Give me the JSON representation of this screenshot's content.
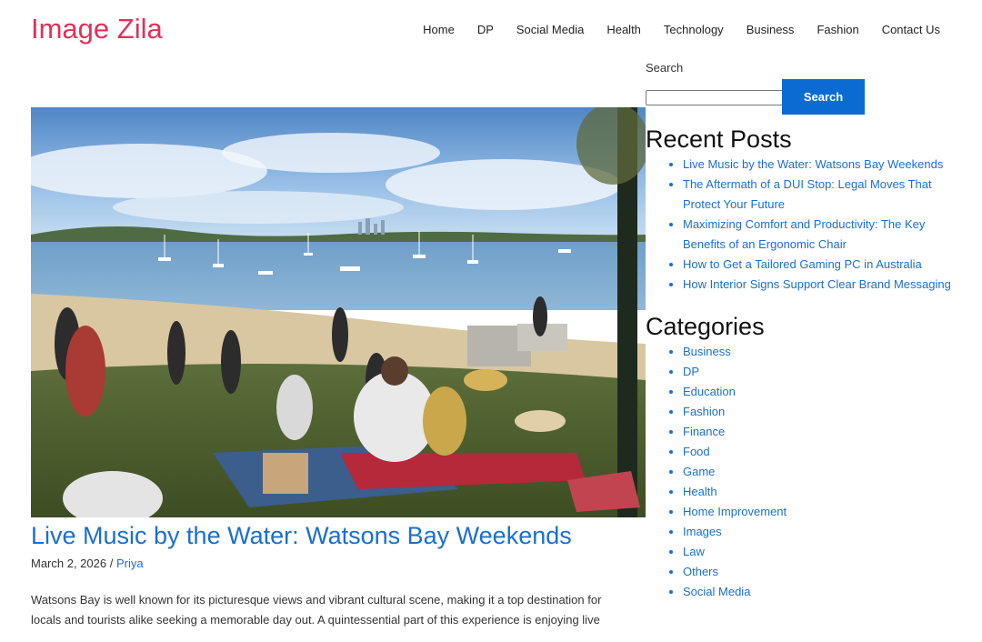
{
  "site": {
    "title": "Image Zila"
  },
  "nav": {
    "items": [
      {
        "label": "Home"
      },
      {
        "label": "DP"
      },
      {
        "label": "Social Media"
      },
      {
        "label": "Health"
      },
      {
        "label": "Technology"
      },
      {
        "label": "Business"
      },
      {
        "label": "Fashion"
      },
      {
        "label": "Contact Us"
      }
    ]
  },
  "post": {
    "title": "Live Music by the Water: Watsons Bay Weekends",
    "date": "March 2, 2026",
    "separator": " / ",
    "author": "Priya",
    "excerpt": "Watsons Bay is well known for its picturesque views and vibrant cultural scene, making it a top destination for locals and tourists alike seeking a memorable day out. A quintessential part of this experience is enjoying live"
  },
  "sidebar": {
    "search": {
      "label": "Search",
      "value": "",
      "button_label": "Search"
    },
    "recent_posts": {
      "title": "Recent Posts",
      "items": [
        {
          "label": "Live Music by the Water: Watsons Bay Weekends"
        },
        {
          "label": "The Aftermath of a DUI Stop: Legal Moves That Protect Your Future"
        },
        {
          "label": "Maximizing Comfort and Productivity: The Key Benefits of an Ergonomic Chair"
        },
        {
          "label": "How to Get a Tailored Gaming PC in Australia"
        },
        {
          "label": "How Interior Signs Support Clear Brand Messaging"
        }
      ]
    },
    "categories": {
      "title": "Categories",
      "items": [
        {
          "label": "Business"
        },
        {
          "label": "DP"
        },
        {
          "label": "Education"
        },
        {
          "label": "Fashion"
        },
        {
          "label": "Finance"
        },
        {
          "label": "Food"
        },
        {
          "label": "Game"
        },
        {
          "label": "Health"
        },
        {
          "label": "Home Improvement"
        },
        {
          "label": "Images"
        },
        {
          "label": "Law"
        },
        {
          "label": "Others"
        },
        {
          "label": "Social Media"
        }
      ]
    }
  },
  "colors": {
    "brand": "#e0315a",
    "link": "#1a6fd0",
    "button": "#0b6bd3"
  }
}
